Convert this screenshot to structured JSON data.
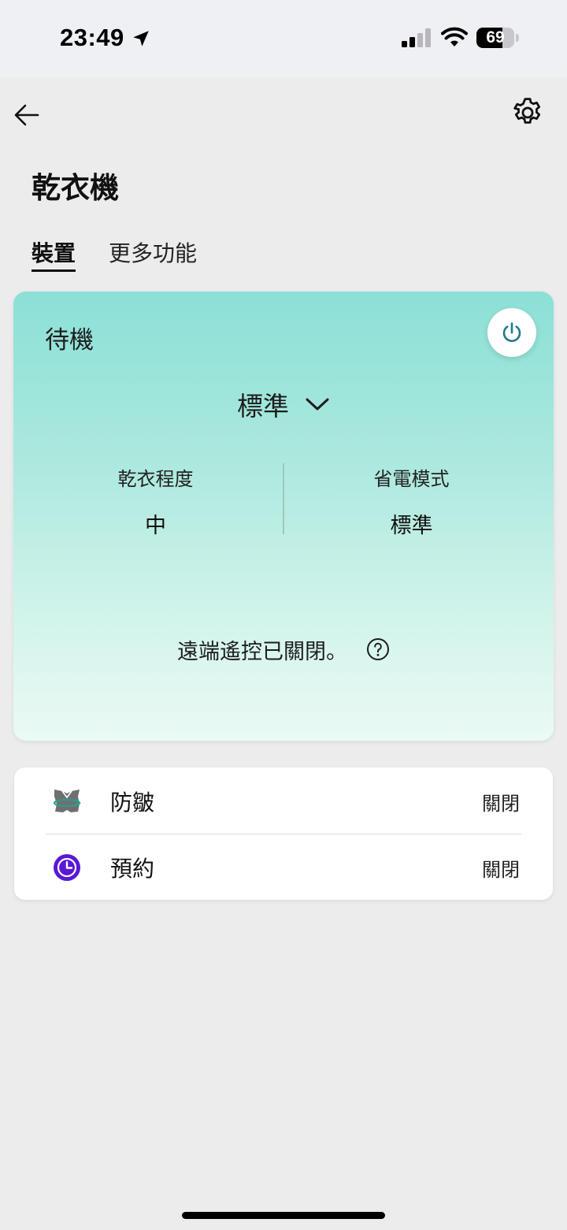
{
  "status_bar": {
    "time": "23:49",
    "battery_percent": "69",
    "battery_level": 0.69,
    "signal_bars_active": 2,
    "signal_bars_total": 4
  },
  "icons": {
    "back": "arrow-left-icon",
    "settings": "gear-icon",
    "power": "power-icon",
    "mode_dropdown": "chevron-down-icon",
    "help": "question-circle-icon",
    "anti_wrinkle": "anti-wrinkle-icon",
    "schedule": "clock-icon"
  },
  "colors": {
    "card_gradient_top": "#8be0d6",
    "card_gradient_bottom": "#ebfaf5",
    "power_icon": "#1e7a8c",
    "schedule_icon": "#5b17d6",
    "anti_wrinkle_green": "#2e9c8a"
  },
  "header": {
    "title": "乾衣機"
  },
  "tabs": [
    {
      "label": "裝置",
      "selected": true
    },
    {
      "label": "更多功能",
      "selected": false
    }
  ],
  "device_card": {
    "status": "待機",
    "mode": "標準",
    "stats": [
      {
        "label": "乾衣程度",
        "value": "中"
      },
      {
        "label": "省電模式",
        "value": "標準"
      }
    ],
    "remote_message": "遠端遙控已關閉。"
  },
  "options": [
    {
      "label": "防皺",
      "value": "關閉"
    },
    {
      "label": "預約",
      "value": "關閉"
    }
  ]
}
